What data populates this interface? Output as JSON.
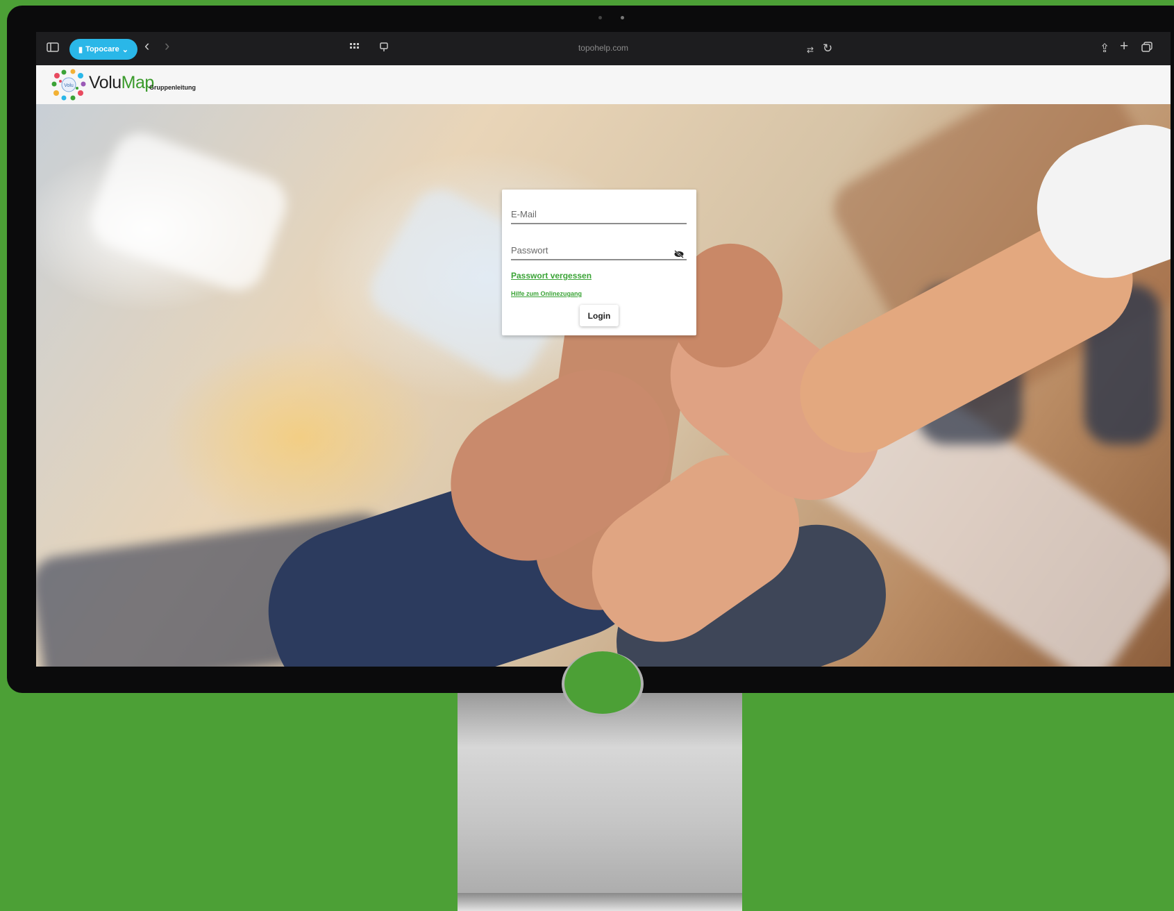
{
  "browser": {
    "tab_group_label": "Topocare",
    "url": "topohelp.com"
  },
  "app": {
    "logo_badge": "Volu",
    "logo_name_part1": "Volu",
    "logo_name_part2": "Map",
    "logo_subtitle": "Gruppenleitung"
  },
  "login": {
    "email_label": "E-Mail",
    "password_label": "Passwort",
    "forgot_link": "Passwort vergessen",
    "help_link": "Hilfe zum Onlinezugang",
    "login_button": "Login"
  },
  "colors": {
    "background": "#4ca036",
    "accent_green": "#3aa336",
    "tab_pill": "#2ab7e8"
  }
}
